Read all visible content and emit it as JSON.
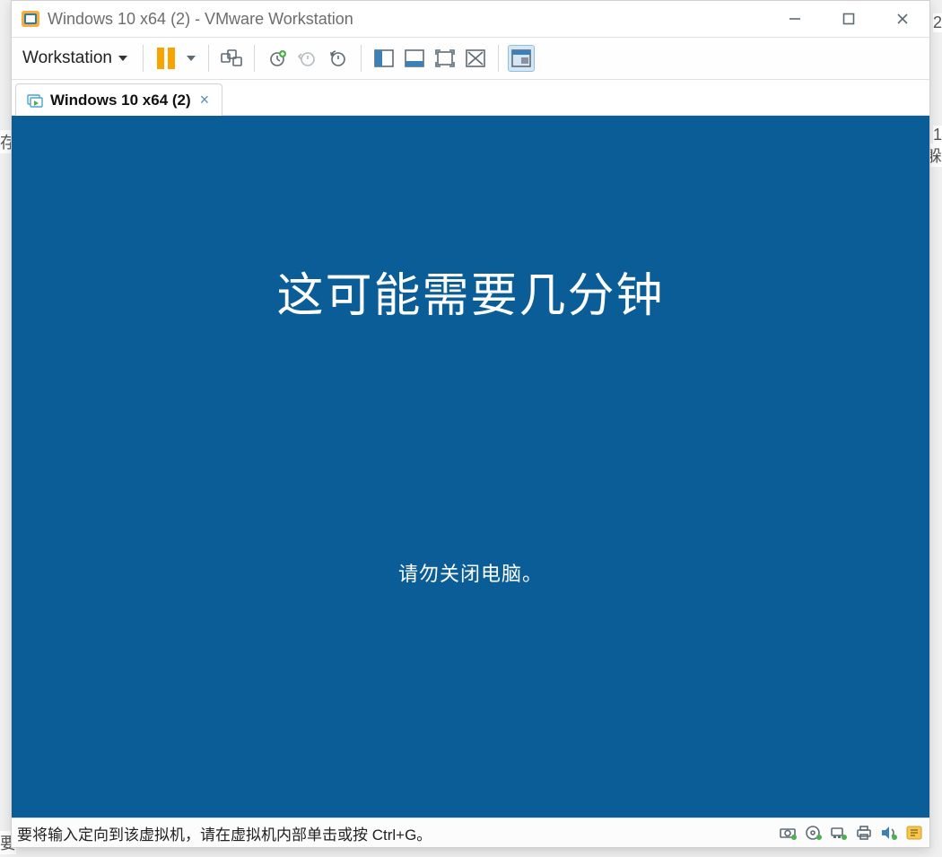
{
  "window": {
    "title": "Windows 10 x64 (2) - VMware Workstation"
  },
  "toolbar": {
    "menu_label": "Workstation"
  },
  "tabs": [
    {
      "label": "Windows 10 x64 (2)"
    }
  ],
  "guest": {
    "primary_text": "这可能需要几分钟",
    "secondary_text": "请勿关闭电脑。"
  },
  "status": {
    "hint": "要将输入定向到该虚拟机，请在虚拟机内部单击或按 Ctrl+G。"
  },
  "background": {
    "left_char": "存",
    "right_top": "2",
    "right_mid1": "1",
    "right_mid2": "躲",
    "left_bottom": "要"
  }
}
